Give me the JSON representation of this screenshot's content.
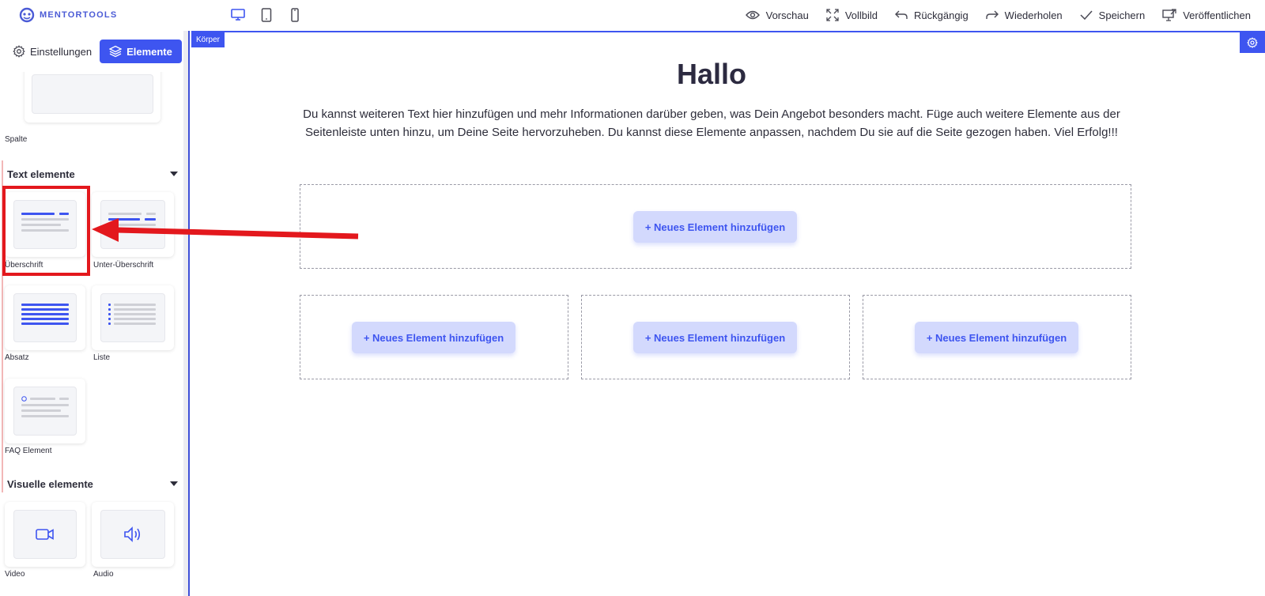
{
  "app": {
    "logo_text": "MENTORTOOLS"
  },
  "header": {
    "devices": [
      "desktop-icon",
      "tablet-icon",
      "mobile-icon"
    ],
    "actions": [
      {
        "icon": "eye-icon",
        "label": "Vorschau"
      },
      {
        "icon": "fullscreen-icon",
        "label": "Vollbild"
      },
      {
        "icon": "undo-icon",
        "label": "Rückgängig"
      },
      {
        "icon": "redo-icon",
        "label": "Wiederholen"
      },
      {
        "icon": "check-icon",
        "label": "Speichern"
      },
      {
        "icon": "publish-icon",
        "label": "Veröffentlichen"
      }
    ]
  },
  "sidebar": {
    "tabs": {
      "settings": "Einstellungen",
      "elements": "Elemente"
    },
    "layout_card": {
      "label": "Spalte"
    },
    "text_section": {
      "title": "Text elemente",
      "items": [
        "Überschrift",
        "Unter-Überschrift",
        "Absatz",
        "Liste",
        "FAQ Element"
      ]
    },
    "visual_section": {
      "title": "Visuelle elemente",
      "items": [
        "Video",
        "Audio"
      ]
    }
  },
  "canvas": {
    "body_tag": "Körper",
    "title": "Hallo",
    "text": "Du kannst weiteren Text hier hinzufügen und mehr Informationen darüber geben, was Dein Angebot besonders macht. Füge auch weitere Elemente aus der Seitenleiste unten hinzu, um Deine Seite hervorzuheben. Du kannst diese Elemente anpassen, nachdem Du sie auf die Seite gezogen haben. Viel Erfolg!!!",
    "add_button_label": "+ Neues Element hinzufügen"
  },
  "colors": {
    "accent": "#3e55f0",
    "accent_light": "#d3d9fd",
    "highlight": "#e3181d"
  }
}
